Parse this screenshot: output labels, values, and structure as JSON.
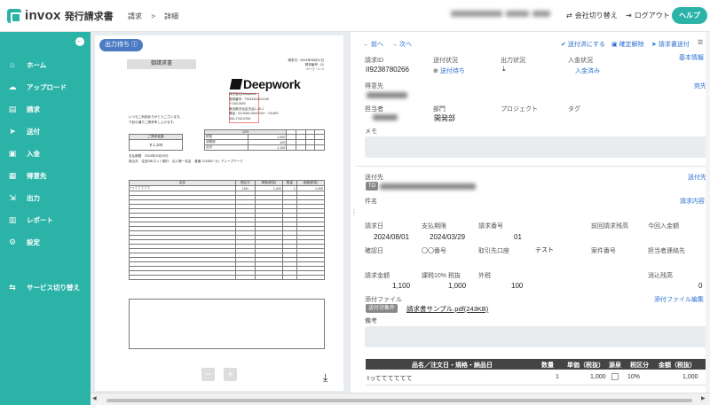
{
  "app": {
    "name": "invox",
    "subtitle": "発行請求書"
  },
  "breadcrumb": {
    "first": "請求",
    "sep": ">",
    "second": "詳細"
  },
  "header": {
    "switch_company": "会社切り替え",
    "logout": "ログアウト",
    "help": "ヘルプ"
  },
  "sidebar": {
    "items": [
      {
        "label": "ホーム",
        "icon": "home-icon"
      },
      {
        "label": "アップロード",
        "icon": "cloud-upload-icon"
      },
      {
        "label": "請求",
        "icon": "document-icon"
      },
      {
        "label": "送付",
        "icon": "send-icon"
      },
      {
        "label": "入金",
        "icon": "wallet-icon"
      },
      {
        "label": "得意先",
        "icon": "building-icon"
      },
      {
        "label": "出力",
        "icon": "export-icon"
      },
      {
        "label": "レポート",
        "icon": "chart-icon"
      },
      {
        "label": "設定",
        "icon": "gear-icon"
      },
      {
        "label": "サービス切り替え",
        "icon": "switch-icon"
      }
    ]
  },
  "preview": {
    "status": "出力待ち",
    "doc_title": "御請求書",
    "meta": [
      "請求日 : 2024年08月01日",
      "請求番号 : 01",
      "ページ : 1 / 1"
    ],
    "brand": "Deepwork",
    "company_lines": [
      "株式会社Deepwork",
      "登録番号 : T5011201021140",
      "〒150-0000",
      "東京都渋谷区渋谷1-25-1",
      "電話 : 03-0000-0000 FAX : +DURS",
      "050-1742-5760"
    ],
    "greeting": [
      "いつもご利用ありがとうございます。",
      "下記の通りご請求申し上げます。"
    ],
    "summary_header": "10%",
    "total_label": "ご請求金額",
    "total_value": "￥1,100",
    "summary_rows": [
      [
        "税抜",
        "1,000"
      ],
      [
        "消費税",
        "100"
      ],
      [
        "合計",
        "1,100"
      ]
    ],
    "due_label": "支払期限",
    "due_value": "2024年03月29日",
    "bank_label": "振込先",
    "bank_value": "住信SBIネット銀行　法人第一支店　普通 1134567 カ）ディープワーク",
    "item_headers": [
      "品名",
      "税区分",
      "単価(税抜)",
      "数量",
      "金額(税抜)"
    ],
    "item_row": [
      "tっててててて",
      "10%",
      "1,000",
      "1",
      "1,000"
    ],
    "pager_prev": "−",
    "pager_next": "+"
  },
  "detail": {
    "nav_prev": "← 前へ",
    "nav_next": "→ 次へ",
    "actions": [
      "送付済にする",
      "確定解除",
      "請求書送付"
    ],
    "basic_info": "基本情報",
    "invoice_id_label": "請求ID",
    "invoice_id": "II9238780266",
    "send_status_label": "送付状況",
    "send_status": "送付待ち",
    "output_status_label": "出力状況",
    "payment_status_label": "入金状況",
    "payment_status": "入金済み",
    "customer_label": "得意先",
    "customer_link": "宛先",
    "owner_label": "担当者",
    "dept_label": "部門",
    "dept_value": "開発部",
    "project_label": "プロジェクト",
    "tag_label": "タグ",
    "memo_label": "メモ",
    "sendto_label": "送付先",
    "sendto_link": "送付先",
    "sendto_chip": "TO",
    "subject_label": "件名",
    "invoice_content_link": "請求内容",
    "fields_row1": [
      {
        "label": "請求日",
        "value": "2024/08/01"
      },
      {
        "label": "支払期限",
        "value": "2024/03/29"
      },
      {
        "label": "請求番号",
        "value": "01"
      },
      {
        "label": "前回請求残高",
        "value": ""
      },
      {
        "label": "今回入金額",
        "value": ""
      }
    ],
    "fields_row2": [
      {
        "label": "確認日",
        "value": ""
      },
      {
        "label": "〇〇番号",
        "value": ""
      },
      {
        "label": "取引先口座",
        "value": "テスト"
      },
      {
        "label": "案件番号",
        "value": ""
      },
      {
        "label": "担当者連絡先",
        "value": ""
      }
    ],
    "fields_row3": [
      {
        "label": "請求金額",
        "value": "1,100"
      },
      {
        "label": "課税10% 税抜",
        "value": "1,000"
      },
      {
        "label": "外税",
        "value": "100"
      },
      {
        "label": "消込残高",
        "value": "0"
      }
    ],
    "attachment_label": "添付ファイル",
    "attachment_edit": "添付ファイル編集",
    "attachment_chip": "送付対象外",
    "attachment_file": "請求書サンプル.pdf(243KB)",
    "remarks_label": "備考",
    "items_headers": [
      "品名／注文日・規格・納品日",
      "数量",
      "単価（税抜）",
      "源泉",
      "税区分",
      "金額（税抜）"
    ],
    "items_row": [
      "tってててててて",
      "1",
      "1,000",
      "10%",
      "1,000"
    ]
  },
  "colors": {
    "brand": "#2bb3a8",
    "link": "#2a6fcf",
    "pill": "#4a7bc4"
  }
}
